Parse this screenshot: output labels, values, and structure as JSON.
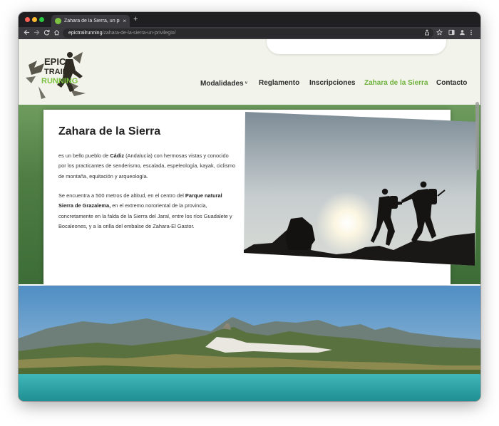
{
  "browser": {
    "tab_title": "Zahara de la Sierra, un privilegio",
    "tab_close": "×",
    "new_tab": "+",
    "url_host": "epictrailrunning",
    "url_path": "/zahara-de-la-sierra-un-privilegio/",
    "icons": [
      "back-arrow-icon",
      "forward-arrow-icon",
      "reload-icon",
      "home-icon",
      "share-icon",
      "bookmark-star-icon",
      "sidebar-icon",
      "profile-icon",
      "menu-dots-icon"
    ]
  },
  "site": {
    "logo": {
      "line1": "EPIC",
      "line2": "TRAIL",
      "line3": "RUNNING"
    },
    "nav": [
      {
        "label": "Modalidades",
        "has_caret": true,
        "active": false
      },
      {
        "label": "Reglamento",
        "active": false
      },
      {
        "label": "Inscripciones",
        "active": false
      },
      {
        "label": "Zahara de la Sierra",
        "active": true
      },
      {
        "label": "Contacto",
        "active": false
      }
    ],
    "nav_caret": "˅",
    "active_color": "#6fb23c"
  },
  "content": {
    "title": "Zahara de la Sierra",
    "p1": {
      "a": "es un bello pueblo de ",
      "b": "Cádiz",
      "c": " (Andalucía) con hermosas vistas y conocido por los practicantes de senderismo, escalada, espeleología, kayak, ciclismo de montaña, equitación y arqueología."
    },
    "p2": {
      "a": "Se encuentra a 500 metros de altitud, en el centro del ",
      "b": "Parque natural Sierra de Grazalema,",
      "c": " en el extremo nororiental de la provincia, concretamente en la falda de la Sierra del Jaral, entre los ríos Guadalete y Bocaleones, y a la orilla del embalse de Zahara-El Gastor."
    }
  }
}
